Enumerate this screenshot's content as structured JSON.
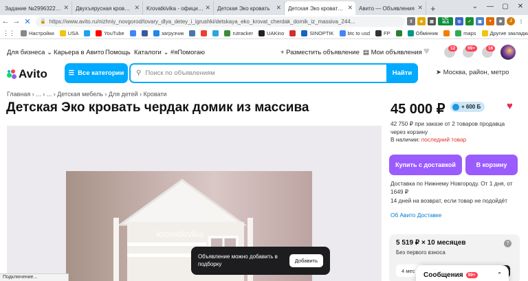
{
  "browser": {
    "tabs": [
      {
        "title": "Задание №2996322 - п",
        "favicon": "SP",
        "color": "#d0342c"
      },
      {
        "title": "Двухъярусная кровать",
        "favicon": "",
        "color": "#3ba0ff"
      },
      {
        "title": "Krovatkivika - официал",
        "favicon": "",
        "color": "#3ba0ff"
      },
      {
        "title": "Детская Эко кровать",
        "favicon": "",
        "color": "#3ba0ff"
      },
      {
        "title": "Детская Эко кровать чердак",
        "favicon": "",
        "color": "#3ba0ff"
      },
      {
        "title": "Авито — Объявления",
        "favicon": "",
        "color": "#3ba0ff"
      }
    ],
    "url": "https://www.avito.ru/nizhniy_novgorod/tovary_dlya_detey_i_igrushki/detskaya_eko_krovat_cherdak_domik_iz_massiva_244...",
    "bookmarks": [
      "Настройки",
      "USA",
      "",
      "YouTube",
      "",
      "",
      "загрузчик",
      "",
      "",
      "",
      "rutracker",
      "UAKino",
      "",
      "SINOPTIK",
      "btc to usd",
      "FP",
      "",
      "Обмінник",
      "",
      "maps",
      "Другие закладки"
    ],
    "ext_widget_ltc": "LTC",
    "ext_widget_value": "45.6",
    "status_text": "Подключение..."
  },
  "header": {
    "nav": [
      "Для бизнеса ⌄",
      "Карьера в Авито",
      "Помощь",
      "Каталоги ⌄",
      "#яПомогаю"
    ],
    "post_ad": "+ Разместить объявление",
    "my_ads": "Мои объявления",
    "badges": [
      "12",
      "99+",
      "16"
    ],
    "logo_text": "Avito",
    "categories_button": "Все категории",
    "search_placeholder": "Поиск по объявлениям",
    "search_button": "Найти",
    "location": "Москва, район, метро"
  },
  "breadcrumb": "Главная  ›  ...  ›  ...  ›  Детская мебель  ›  Для детей  ›  Кровати",
  "listing": {
    "title": "Детская Эко кровать чердак домик из массива",
    "price": "45 000 ₽",
    "bonus": "+ 600 Б",
    "bulk_note": "42 750 ₽ при заказе от 2 товаров продавца через корзину",
    "stock_label": "В наличии:",
    "stock_value": "последний товар",
    "buy_button": "Купить с доставкой",
    "cart_button": "В корзину",
    "delivery_note": "Доставка по Нижнему Новгороду. От 1 дня, от 1649 ₽",
    "return_note": "14 дней на возврат, если товар не подойдёт",
    "delivery_link": "Об Авито Доставке",
    "installment_amount": "5 519 ₽ × 10 месяцев",
    "installment_sub": "Без первого взноса",
    "installment_option": "4 мес",
    "watermark": "krovatkivika"
  },
  "toast": {
    "message": "Объявление можно добавить в подборку",
    "button": "Добавить"
  },
  "messages": {
    "label": "Сообщения",
    "count": "99+"
  }
}
